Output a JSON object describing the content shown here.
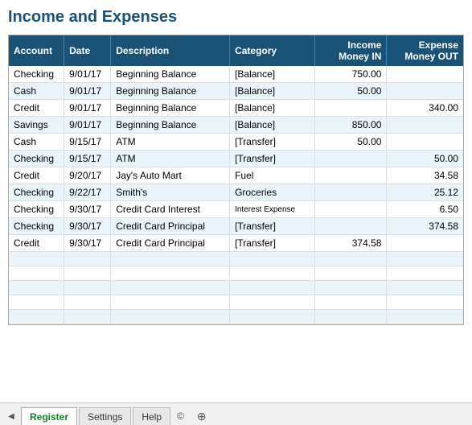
{
  "title": "Income and Expenses",
  "table": {
    "headers": [
      {
        "label": "Account",
        "align": "left",
        "class": "col-account"
      },
      {
        "label": "Date",
        "align": "left",
        "class": "col-date"
      },
      {
        "label": "Description",
        "align": "left",
        "class": "col-desc"
      },
      {
        "label": "Category",
        "align": "left",
        "class": "col-cat"
      },
      {
        "label": "Income\nMoney IN",
        "align": "right",
        "class": "col-income"
      },
      {
        "label": "Expense\nMoney OUT",
        "align": "right",
        "class": "col-expense"
      }
    ],
    "rows": [
      {
        "account": "Checking",
        "date": "9/01/17",
        "desc": "Beginning Balance",
        "cat": "[Balance]",
        "income": "750.00",
        "expense": ""
      },
      {
        "account": "Cash",
        "date": "9/01/17",
        "desc": "Beginning Balance",
        "cat": "[Balance]",
        "income": "50.00",
        "expense": ""
      },
      {
        "account": "Credit",
        "date": "9/01/17",
        "desc": "Beginning Balance",
        "cat": "[Balance]",
        "income": "",
        "expense": "340.00"
      },
      {
        "account": "Savings",
        "date": "9/01/17",
        "desc": "Beginning Balance",
        "cat": "[Balance]",
        "income": "850.00",
        "expense": ""
      },
      {
        "account": "Cash",
        "date": "9/15/17",
        "desc": "ATM",
        "cat": "[Transfer]",
        "income": "50.00",
        "expense": ""
      },
      {
        "account": "Checking",
        "date": "9/15/17",
        "desc": "ATM",
        "cat": "[Transfer]",
        "income": "",
        "expense": "50.00"
      },
      {
        "account": "Credit",
        "date": "9/20/17",
        "desc": "Jay's Auto Mart",
        "cat": "Fuel",
        "income": "",
        "expense": "34.58"
      },
      {
        "account": "Checking",
        "date": "9/22/17",
        "desc": "Smith's",
        "cat": "Groceries",
        "income": "",
        "expense": "25.12"
      },
      {
        "account": "Checking",
        "date": "9/30/17",
        "desc": "Credit Card Interest",
        "cat": "Interest Expense",
        "income": "",
        "expense": "6.50"
      },
      {
        "account": "Checking",
        "date": "9/30/17",
        "desc": "Credit Card Principal",
        "cat": "[Transfer]",
        "income": "",
        "expense": "374.58"
      },
      {
        "account": "Credit",
        "date": "9/30/17",
        "desc": "Credit Card Principal",
        "cat": "[Transfer]",
        "income": "374.58",
        "expense": ""
      },
      {
        "account": "",
        "date": "",
        "desc": "",
        "cat": "",
        "income": "",
        "expense": ""
      },
      {
        "account": "",
        "date": "",
        "desc": "",
        "cat": "",
        "income": "",
        "expense": ""
      },
      {
        "account": "",
        "date": "",
        "desc": "",
        "cat": "",
        "income": "",
        "expense": ""
      },
      {
        "account": "",
        "date": "",
        "desc": "",
        "cat": "",
        "income": "",
        "expense": ""
      },
      {
        "account": "",
        "date": "",
        "desc": "",
        "cat": "",
        "income": "",
        "expense": ""
      }
    ]
  },
  "tabs": [
    {
      "label": "Register",
      "active": true
    },
    {
      "label": "Settings",
      "active": false
    },
    {
      "label": "Help",
      "active": false
    },
    {
      "label": "©",
      "active": false
    }
  ],
  "tab_plus": "+",
  "nav_arrow": "◀"
}
